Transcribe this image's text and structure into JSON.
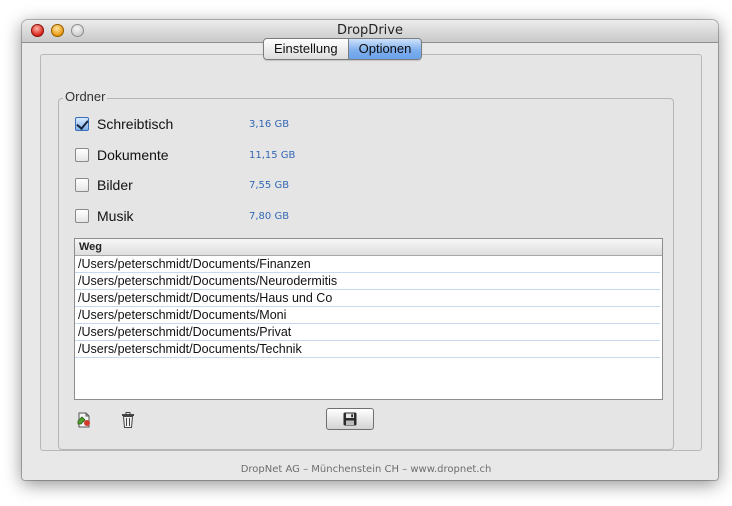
{
  "window": {
    "title": "DropDrive"
  },
  "tabs": [
    {
      "label": "Einstellung",
      "active": false
    },
    {
      "label": "Optionen",
      "active": true
    }
  ],
  "folders_group": {
    "title": "Ordner",
    "items": [
      {
        "label": "Schreibtisch",
        "size": "3,16 GB",
        "checked": true
      },
      {
        "label": "Dokumente",
        "size": "11,15 GB",
        "checked": false
      },
      {
        "label": "Bilder",
        "size": "7,55 GB",
        "checked": false
      },
      {
        "label": "Musik",
        "size": "7,80 GB",
        "checked": false
      }
    ]
  },
  "paths_table": {
    "column_header": "Weg",
    "rows": [
      "/Users/peterschmidt/Documents/Finanzen",
      "/Users/peterschmidt/Documents/Neurodermitis",
      "/Users/peterschmidt/Documents/Haus und Co",
      "/Users/peterschmidt/Documents/Moni",
      "/Users/peterschmidt/Documents/Privat",
      "/Users/peterschmidt/Documents/Technik"
    ]
  },
  "toolbar": {
    "add_icon": "add-file-icon",
    "delete_icon": "trash-icon",
    "save_icon": "floppy-disk-icon"
  },
  "footer": {
    "text": "DropNet AG – Münchenstein CH – www.dropnet.ch"
  },
  "colors": {
    "accent": "#6aa2ea",
    "size_text": "#3468b4"
  }
}
